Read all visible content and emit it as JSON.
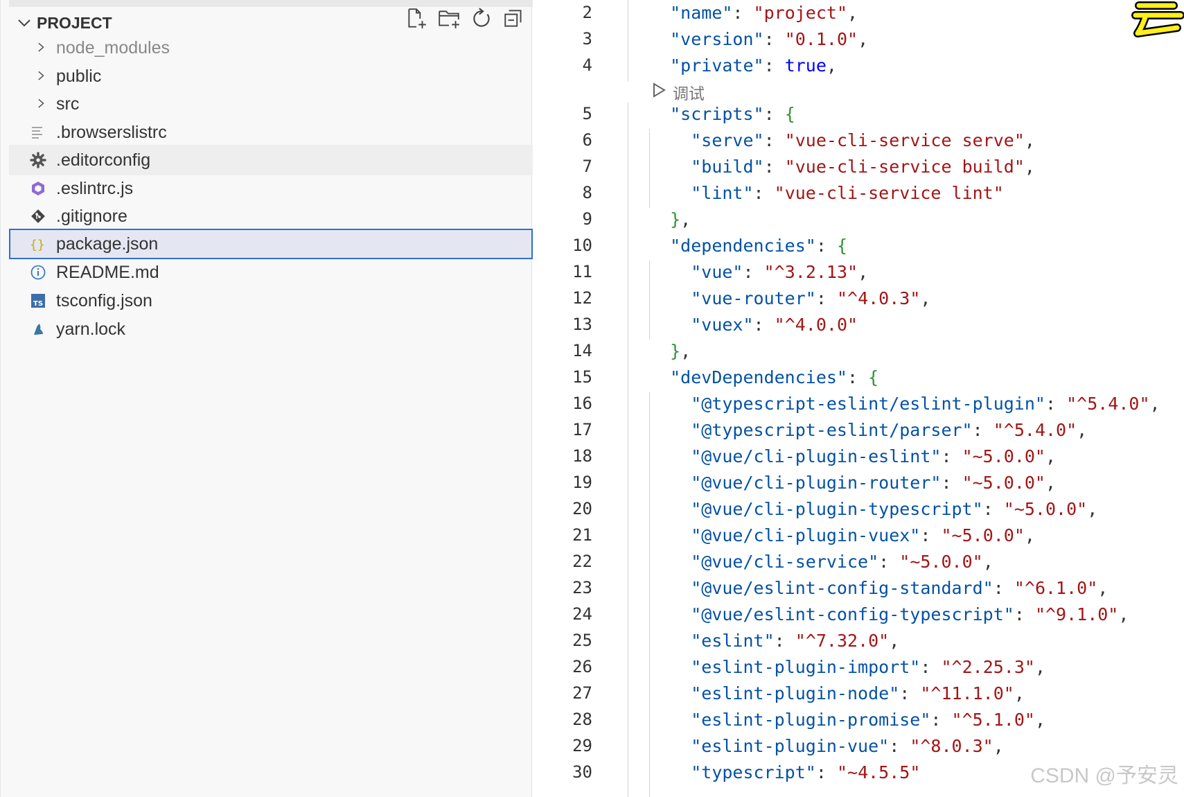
{
  "explorer": {
    "section_title": "PROJECT",
    "actions": [
      {
        "name": "new-file-icon"
      },
      {
        "name": "new-folder-icon"
      },
      {
        "name": "refresh-icon"
      },
      {
        "name": "collapse-all-icon"
      }
    ],
    "items": [
      {
        "label": "node_modules",
        "kind": "folder",
        "icon": "chevron-right-icon",
        "state": "dimmed"
      },
      {
        "label": "public",
        "kind": "folder",
        "icon": "chevron-right-icon",
        "state": "normal"
      },
      {
        "label": "src",
        "kind": "folder",
        "icon": "chevron-right-icon",
        "state": "normal"
      },
      {
        "label": ".browserslistrc",
        "kind": "file",
        "icon": "lines-file-icon",
        "state": "normal"
      },
      {
        "label": ".editorconfig",
        "kind": "file",
        "icon": "gear-icon",
        "state": "hover"
      },
      {
        "label": ".eslintrc.js",
        "kind": "file",
        "icon": "eslint-icon",
        "state": "normal"
      },
      {
        "label": ".gitignore",
        "kind": "file",
        "icon": "git-icon",
        "state": "normal"
      },
      {
        "label": "package.json",
        "kind": "file",
        "icon": "json-braces-icon",
        "state": "selected"
      },
      {
        "label": "README.md",
        "kind": "file",
        "icon": "info-icon",
        "state": "normal"
      },
      {
        "label": "tsconfig.json",
        "kind": "file",
        "icon": "ts-icon",
        "state": "normal"
      },
      {
        "label": "yarn.lock",
        "kind": "file",
        "icon": "yarn-icon",
        "state": "normal"
      }
    ]
  },
  "editor": {
    "codelens": "调试",
    "lines": [
      {
        "n": "2",
        "t": "  \"name\": \"project\","
      },
      {
        "n": "3",
        "t": "  \"version\": \"0.1.0\","
      },
      {
        "n": "4",
        "t": "  \"private\": true,"
      },
      {
        "n": "5",
        "t": "  \"scripts\": {"
      },
      {
        "n": "6",
        "t": "    \"serve\": \"vue-cli-service serve\","
      },
      {
        "n": "7",
        "t": "    \"build\": \"vue-cli-service build\","
      },
      {
        "n": "8",
        "t": "    \"lint\": \"vue-cli-service lint\""
      },
      {
        "n": "9",
        "t": "  },"
      },
      {
        "n": "10",
        "t": "  \"dependencies\": {"
      },
      {
        "n": "11",
        "t": "    \"vue\": \"^3.2.13\","
      },
      {
        "n": "12",
        "t": "    \"vue-router\": \"^4.0.3\","
      },
      {
        "n": "13",
        "t": "    \"vuex\": \"^4.0.0\""
      },
      {
        "n": "14",
        "t": "  },"
      },
      {
        "n": "15",
        "t": "  \"devDependencies\": {"
      },
      {
        "n": "16",
        "t": "    \"@typescript-eslint/eslint-plugin\": \"^5.4.0\","
      },
      {
        "n": "17",
        "t": "    \"@typescript-eslint/parser\": \"^5.4.0\","
      },
      {
        "n": "18",
        "t": "    \"@vue/cli-plugin-eslint\": \"~5.0.0\","
      },
      {
        "n": "19",
        "t": "    \"@vue/cli-plugin-router\": \"~5.0.0\","
      },
      {
        "n": "20",
        "t": "    \"@vue/cli-plugin-typescript\": \"~5.0.0\","
      },
      {
        "n": "21",
        "t": "    \"@vue/cli-plugin-vuex\": \"~5.0.0\","
      },
      {
        "n": "22",
        "t": "    \"@vue/cli-service\": \"~5.0.0\","
      },
      {
        "n": "23",
        "t": "    \"@vue/eslint-config-standard\": \"^6.1.0\","
      },
      {
        "n": "24",
        "t": "    \"@vue/eslint-config-typescript\": \"^9.1.0\","
      },
      {
        "n": "25",
        "t": "    \"eslint\": \"^7.32.0\","
      },
      {
        "n": "26",
        "t": "    \"eslint-plugin-import\": \"^2.25.3\","
      },
      {
        "n": "27",
        "t": "    \"eslint-plugin-node\": \"^11.1.0\","
      },
      {
        "n": "28",
        "t": "    \"eslint-plugin-promise\": \"^5.1.0\","
      },
      {
        "n": "29",
        "t": "    \"eslint-plugin-vue\": \"^8.0.3\","
      },
      {
        "n": "30",
        "t": "    \"typescript\": \"~4.5.5\""
      }
    ]
  },
  "watermark": "CSDN @予安灵",
  "colors": {
    "selection_border": "#2f6fd1",
    "json_key": "#0451a5",
    "json_string": "#a31515",
    "json_boolean": "#0000ff",
    "bracket": "#319331"
  }
}
